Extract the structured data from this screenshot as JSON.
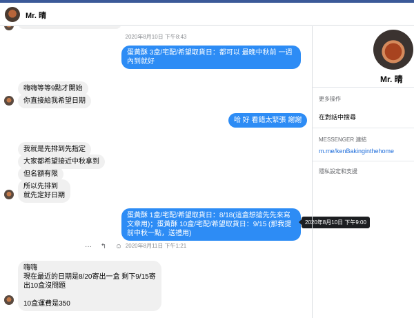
{
  "header": {
    "name": "Mr. 晴"
  },
  "messages": {
    "t1": "2020年8月10日 下午8:43",
    "out1": "蛋黃酥  3盒/宅配/希望取貨日：都可以  最晚中秋前  一週內到就好",
    "in1": "嗨嗨等等9點才開始",
    "in2": "你直接給我希望日期",
    "out2": "哈  好  看錯太緊張  謝謝",
    "in3": "我就是先排到先指定",
    "in4": "大家都希望接近中秋拿到",
    "in5": "但名額有限",
    "in6": "所以先排到\n就先定好日期",
    "out3": "蛋黃酥  1盒/宅配/希望取貨日：8/18(這盒想搶先先來寫文章用)；蛋黃酥  10盒/宅配/希望取貨日：9/15 (那我提前中秋一點，送禮用)",
    "tooltip": "2020年8月10日 下午9:00",
    "t2": "2020年8月11日 下午1:21",
    "in7": "嗨嗨\n現在最近的日期是8/20寄出一盒  剩下9/15寄出10盒沒問題\n\n10盒運費是350"
  },
  "actions": {
    "more": "···",
    "reply": "↰",
    "react": "☺"
  },
  "sidebar": {
    "name": "Mr. 晴",
    "more_actions_label": "更多操作",
    "search_in_chat": "在對話中搜尋",
    "messenger_link_label": "MESSENGER 連結",
    "messenger_link": "m.me/kenBakinginthehome",
    "privacy_support": "隱私設定和支援"
  }
}
